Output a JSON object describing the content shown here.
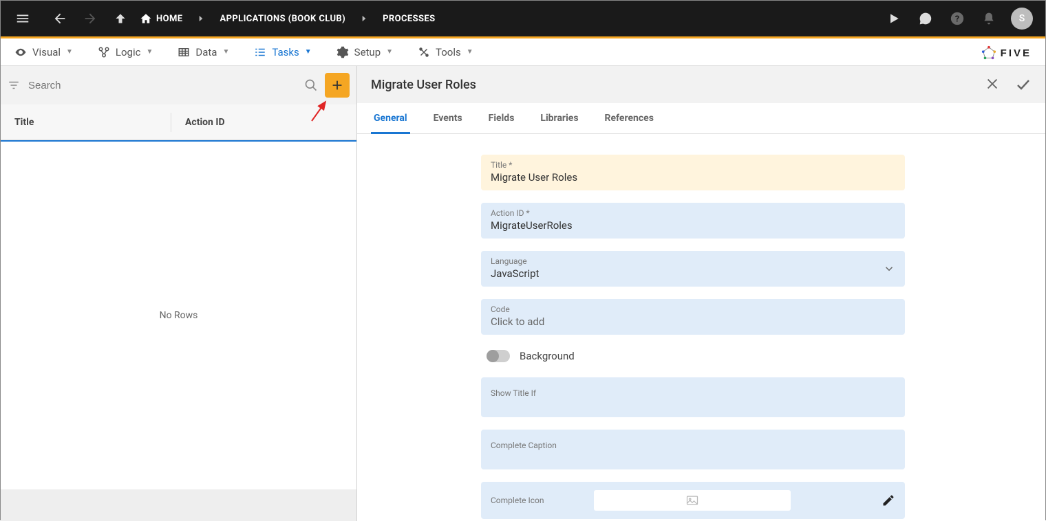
{
  "topbar": {
    "hamburger": "menu",
    "back": "back",
    "forward": "forward",
    "up": "up"
  },
  "breadcrumbs": [
    {
      "label": "HOME",
      "icon": "home"
    },
    {
      "label": "APPLICATIONS (BOOK CLUB)"
    },
    {
      "label": "PROCESSES"
    }
  ],
  "topbar_right": {
    "play": "run",
    "comment": "feedback",
    "help": "help",
    "bell": "notifications",
    "avatar_initial": "S"
  },
  "main_tabs": [
    {
      "label": "Visual",
      "icon": "eye",
      "active": false
    },
    {
      "label": "Logic",
      "icon": "logic",
      "active": false
    },
    {
      "label": "Data",
      "icon": "table",
      "active": false
    },
    {
      "label": "Tasks",
      "icon": "checklist",
      "active": true
    },
    {
      "label": "Setup",
      "icon": "gear",
      "active": false
    },
    {
      "label": "Tools",
      "icon": "tools",
      "active": false
    }
  ],
  "brand": {
    "text": "FIVE"
  },
  "left_panel": {
    "search_placeholder": "Search",
    "columns": {
      "title": "Title",
      "action_id": "Action ID"
    },
    "no_rows": "No Rows"
  },
  "detail": {
    "title": "Migrate User Roles",
    "sub_tabs": [
      "General",
      "Events",
      "Fields",
      "Libraries",
      "References"
    ],
    "active_sub_tab": "General",
    "form": {
      "title_label": "Title *",
      "title_value": "Migrate User Roles",
      "action_id_label": "Action ID *",
      "action_id_value": "MigrateUserRoles",
      "language_label": "Language",
      "language_value": "JavaScript",
      "code_label": "Code",
      "code_value": "Click to add",
      "background_label": "Background",
      "background_value": false,
      "show_title_if_label": "Show Title If",
      "complete_caption_label": "Complete Caption",
      "complete_icon_label": "Complete Icon"
    }
  }
}
